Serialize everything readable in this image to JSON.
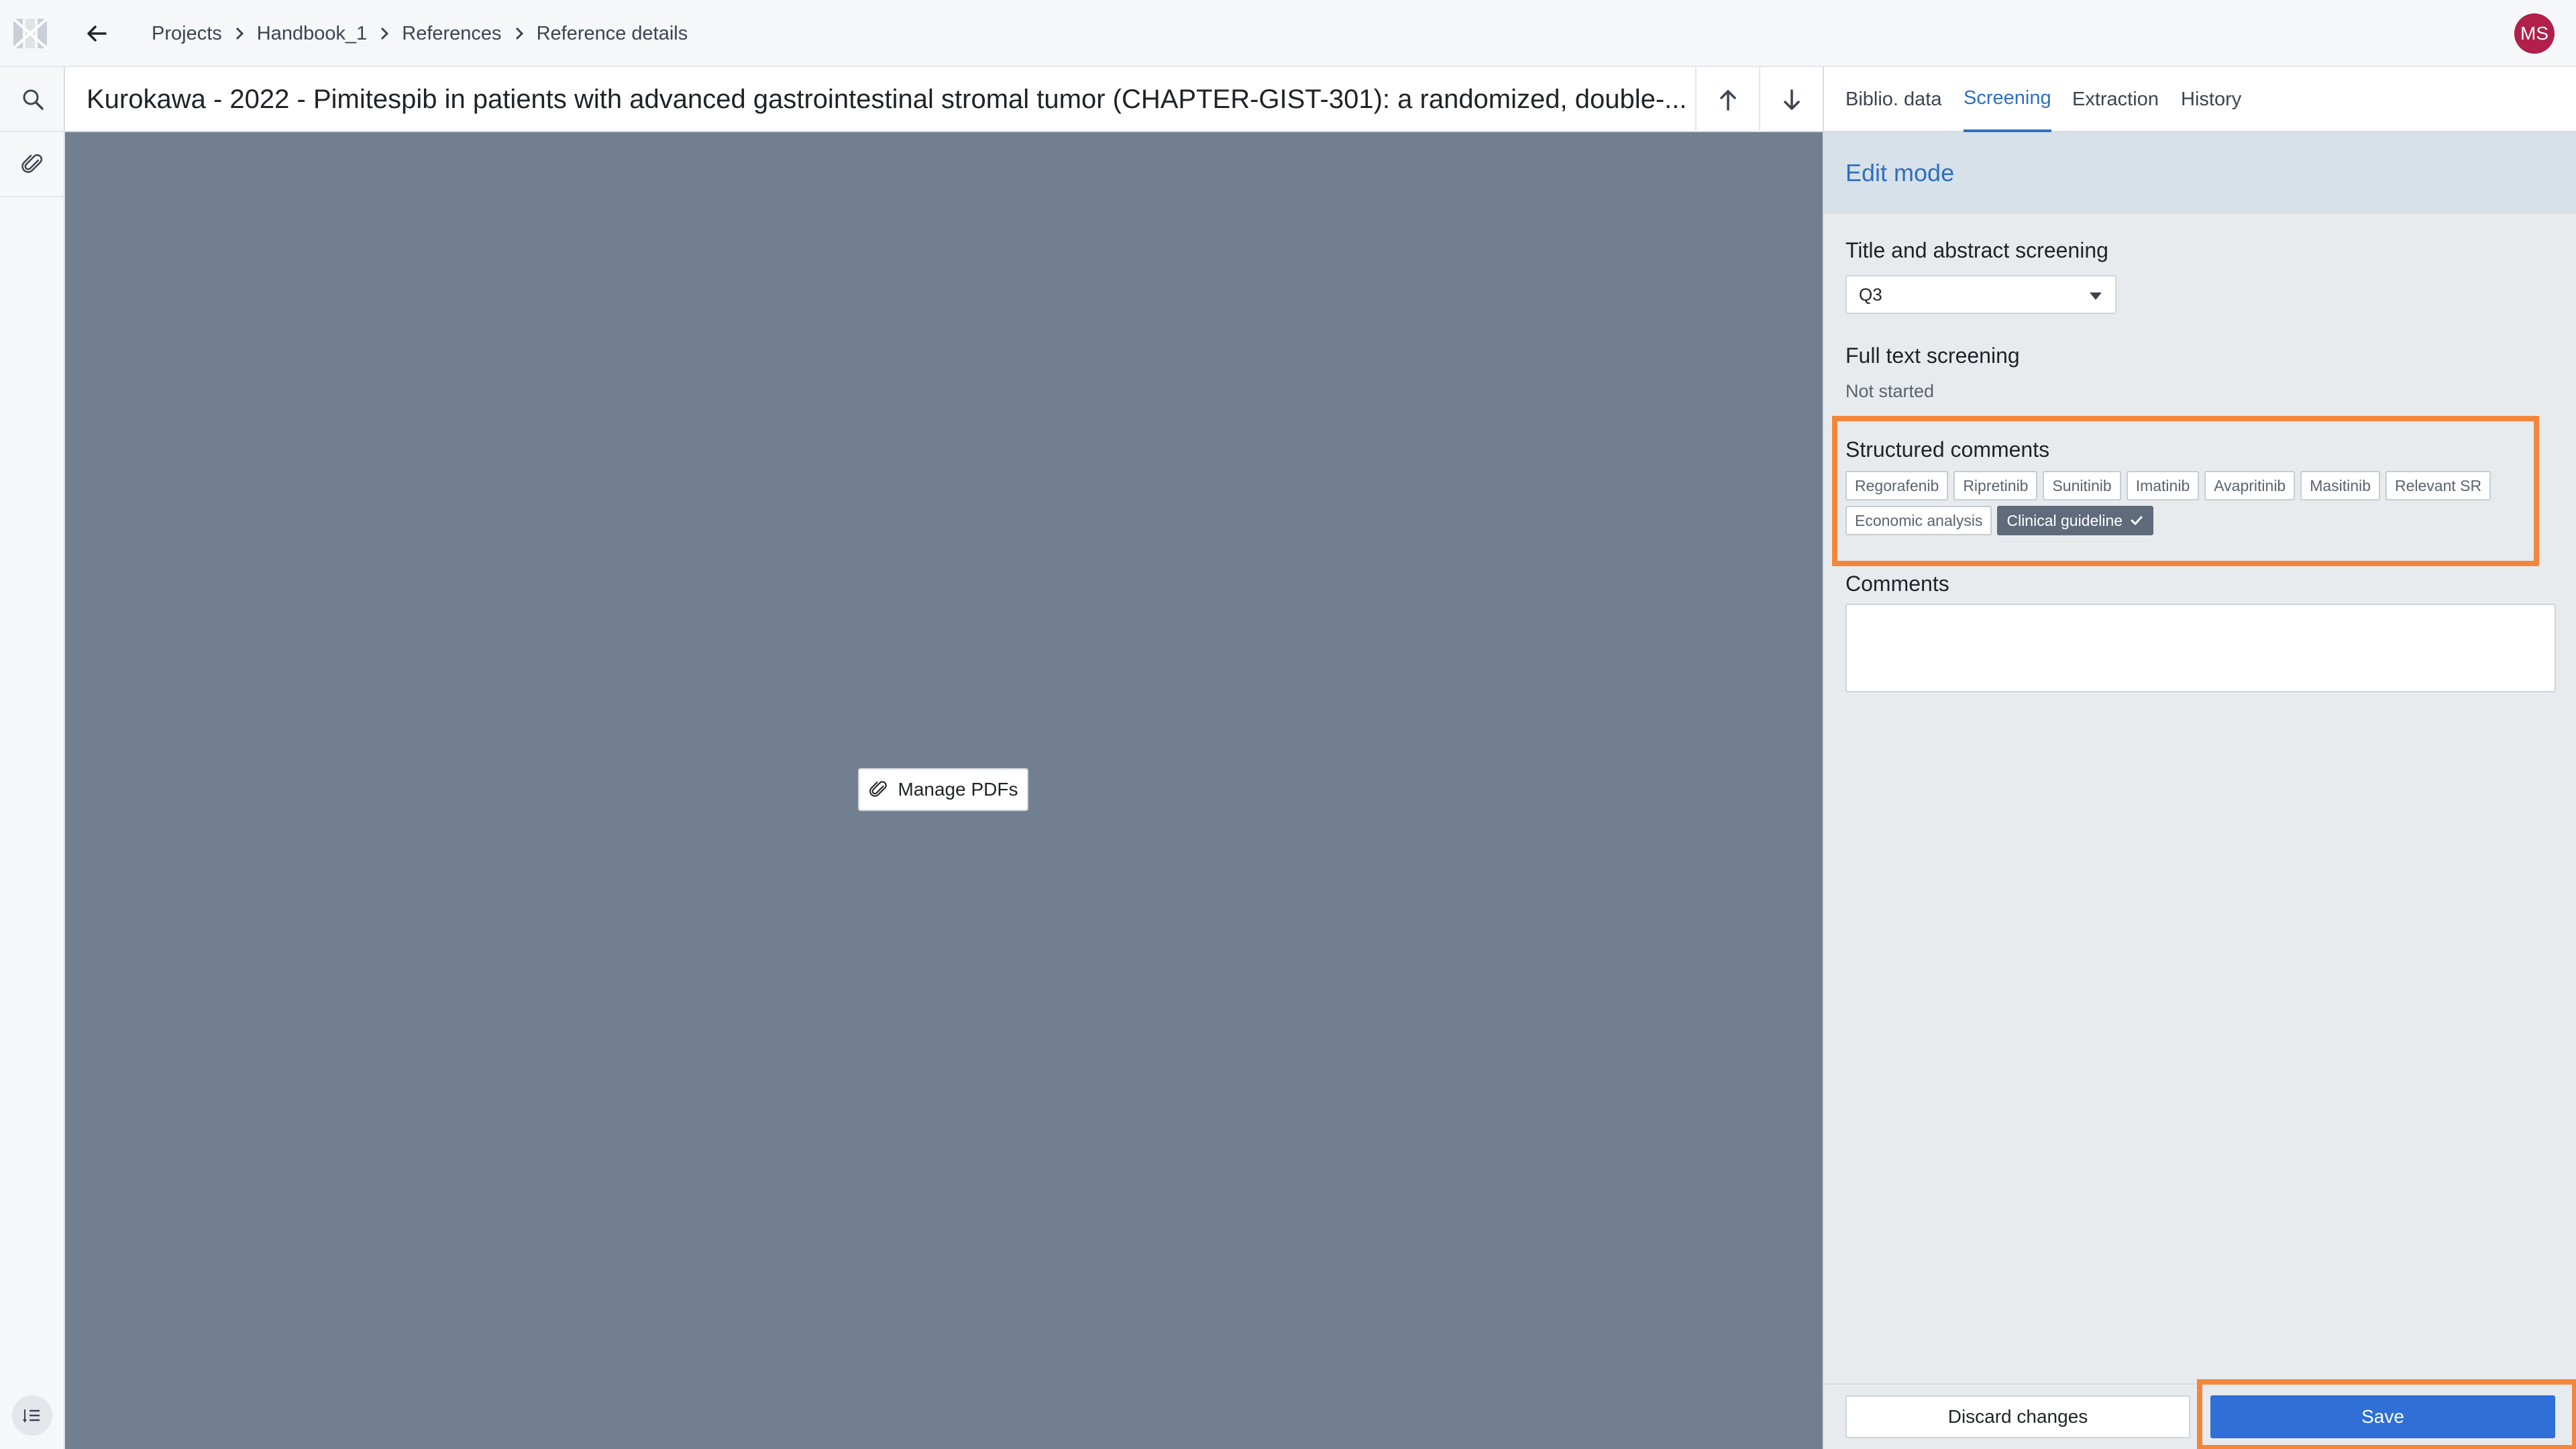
{
  "app": {
    "logo": "app-logo-icon",
    "user_initials": "MS",
    "avatar_color": "#b0204b"
  },
  "breadcrumb": [
    "Projects",
    "Handbook_1",
    "References",
    "Reference details"
  ],
  "reference": {
    "title": "Kurokawa - 2022 - Pimitespib in patients with advanced gastrointestinal stromal tumor (CHAPTER-GIST-301): a randomized, double-..."
  },
  "viewer": {
    "manage_pdfs_label": "Manage PDFs"
  },
  "tabs": [
    {
      "label": "Biblio. data",
      "active": false
    },
    {
      "label": "Screening",
      "active": true
    },
    {
      "label": "Extraction",
      "active": false
    },
    {
      "label": "History",
      "active": false
    }
  ],
  "panel": {
    "mode_label": "Edit mode",
    "title_abstract": {
      "label": "Title and abstract screening",
      "value": "Q3"
    },
    "full_text": {
      "label": "Full text screening",
      "status": "Not started"
    },
    "structured_comments": {
      "label": "Structured comments",
      "row1": [
        "Regorafenib",
        "Ripretinib",
        "Sunitinib",
        "Imatinib",
        "Avapritinib",
        "Masitinib",
        "Relevant SR"
      ],
      "row2_unselected": "Economic analysis",
      "row2_selected": "Clinical guideline"
    },
    "comments": {
      "label": "Comments",
      "value": ""
    }
  },
  "footer": {
    "discard_label": "Discard changes",
    "save_label": "Save"
  },
  "colors": {
    "accent": "#2f6fbf",
    "save_button": "#2f6fd6",
    "highlight": "#f4863b",
    "viewer_bg": "#717f91"
  }
}
